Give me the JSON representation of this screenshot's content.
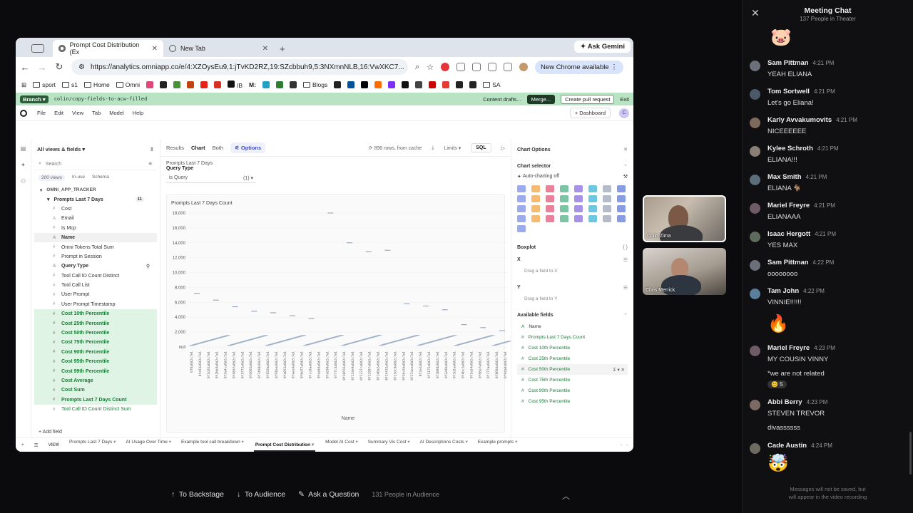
{
  "browser": {
    "tabs": [
      {
        "label": "Prompt Cost Distribution (Ex",
        "active": true
      },
      {
        "label": "New Tab",
        "active": false
      }
    ],
    "new_tab_symbol": "+",
    "gemini_label": "Ask Gemini",
    "url": "https://analytics.omniapp.co/e/4:XZOysEu9,1:jTvKD2RZ,19:SZcbbuh9,5:3NXmnNLB,16:VwXKC7...",
    "new_chrome_label": "New Chrome available",
    "bookmarks": [
      "sport",
      "s1",
      "Home",
      "Omni",
      "IB",
      "M:",
      "Blogs",
      "SA"
    ]
  },
  "branch_bar": {
    "pill": "Branch",
    "name": "colin/copy-fields-to-acw-filled",
    "drafts": "Content drafts...",
    "merge": "Merge...",
    "pr": "Create pull request",
    "exit": "Exit"
  },
  "app_menu": {
    "items": [
      "File",
      "Edit",
      "View",
      "Tab",
      "Model",
      "Help"
    ],
    "dashboard": "Dashboard",
    "avatar": "C"
  },
  "fields_panel": {
    "header": "All views & fields",
    "search_placeholder": "Search",
    "pills": [
      "200 views",
      "In-use",
      "Schema"
    ],
    "view_name": "OMNI_APP_TRACKER",
    "group": "Prompts Last 7 Days",
    "group_count": "11",
    "fields": [
      "Cost",
      "Email",
      "Is Mcp",
      "Name",
      "Omni Tokens Total Sum",
      "Prompt in Session",
      "Query Type",
      "Tool Call ID Count Distinct",
      "Tool Call List",
      "User Prompt",
      "User Prompt Timestamp"
    ],
    "measures": [
      "Cost 10th Percentile",
      "Cost 25th Percentile",
      "Cost 50th Percentile",
      "Cost 75th Percentile",
      "Cost 90th Percentile",
      "Cost 95th Percentile",
      "Cost 99th Percentile",
      "Cost Average",
      "Cost Sum",
      "Prompts Last 7 Days Count"
    ],
    "last": "Tool Call ID Count Distinct Sum",
    "add_field": "Add field"
  },
  "center": {
    "tabs": [
      "Results",
      "Chart",
      "Both"
    ],
    "options": "Options",
    "rows_info": "896 rows, from cache",
    "limits": "Limits",
    "sql": "SQL",
    "filter_caption": "Prompts Last 7 Days",
    "filter_title": "Query Type",
    "filter_value": "is Query",
    "filter_count": "(1)"
  },
  "chart_data": {
    "type": "scatter",
    "title": "Prompts Last 7 Days Count",
    "xlabel": "Name",
    "ylabel": "",
    "ylim": [
      0,
      18000
    ],
    "yticks": [
      "null",
      "2,000",
      "4,000",
      "6,000",
      "8,000",
      "10,000",
      "12,000",
      "14,000",
      "16,000",
      "18,000"
    ],
    "series": [
      {
        "values": [
          7200,
          6300,
          5400,
          4800,
          4600,
          4200,
          3800,
          18000,
          14000,
          12800,
          13000,
          5800,
          5500,
          5000,
          3000,
          2600,
          2200
        ]
      }
    ]
  },
  "options_panel": {
    "title": "Chart Options",
    "chart_selector": "Chart selector",
    "auto_charting": "Auto-charting off",
    "boxplot": "Boxplot",
    "x_label": "X",
    "x_drop": "Drag a field to X",
    "y_label": "Y",
    "y_drop": "Drag a field to Y",
    "available": "Available fields",
    "available_fields": [
      "Name",
      "Prompts Last 7 Days Count",
      "Cost 10th Percentile",
      "Cost 25th Percentile",
      "Cost 50th Percentile",
      "Cost 75th Percentile",
      "Cost 90th Percentile",
      "Cost 95th Percentile"
    ]
  },
  "bottom_tabs": {
    "view": "VIEW",
    "tabs": [
      "Prompts Last 7 Days",
      "AI Usage Over Time",
      "Example tool call breakdown",
      "Prompt Cost Distribution",
      "Model AI Cost",
      "Summary Vis Cost",
      "AI Descriptions Costs",
      "Example prompts"
    ]
  },
  "videos": [
    {
      "label": "Colin Zima"
    },
    {
      "label": "Chris Merrick"
    }
  ],
  "controls": {
    "backstage": "To Backstage",
    "audience": "To Audience",
    "question": "Ask a Question",
    "count": "131 People in Audience"
  },
  "chat": {
    "title": "Meeting Chat",
    "subtitle": "137 People in Theater",
    "messages": [
      {
        "name": "Sam Pittman",
        "time": "4:21 PM",
        "text": "YEAH ELIANA"
      },
      {
        "name": "Tom Sortwell",
        "time": "4:21 PM",
        "text": "Let's go Eliana!"
      },
      {
        "name": "Karly Avvakumovits",
        "time": "4:21 PM",
        "text": "NICEEEEEE"
      },
      {
        "name": "Kylee Schroth",
        "time": "4:21 PM",
        "text": "ELIANA!!!"
      },
      {
        "name": "Max Smith",
        "time": "4:21 PM",
        "text": "ELIANA 🐐"
      },
      {
        "name": "Mariel Freyre",
        "time": "4:21 PM",
        "text": "ELIANAAA"
      },
      {
        "name": "Isaac Hergott",
        "time": "4:21 PM",
        "text": "YES MAX"
      },
      {
        "name": "Sam Pittman",
        "time": "4:22 PM",
        "text": "oooooooo"
      },
      {
        "name": "Tam John",
        "time": "4:22 PM",
        "text": "VINNIE!!!!!!"
      },
      {
        "name": "Mariel Freyre",
        "time": "4:23 PM",
        "text": "MY COUSIN VINNY",
        "extra": "*we are not related",
        "reaction": "😊 5"
      },
      {
        "name": "Abbi Berry",
        "time": "4:23 PM",
        "text": "STEVEN TREVOR",
        "extra": "divassssss"
      },
      {
        "name": "Cade Austin",
        "time": "4:24 PM",
        "text": ""
      }
    ],
    "top_emoji": "🐷",
    "fire_emoji": "🔥",
    "mind_emoji": "🤯",
    "footer_line1": "Messages will not be saved, but",
    "footer_line2": "will appear in the video recording"
  }
}
